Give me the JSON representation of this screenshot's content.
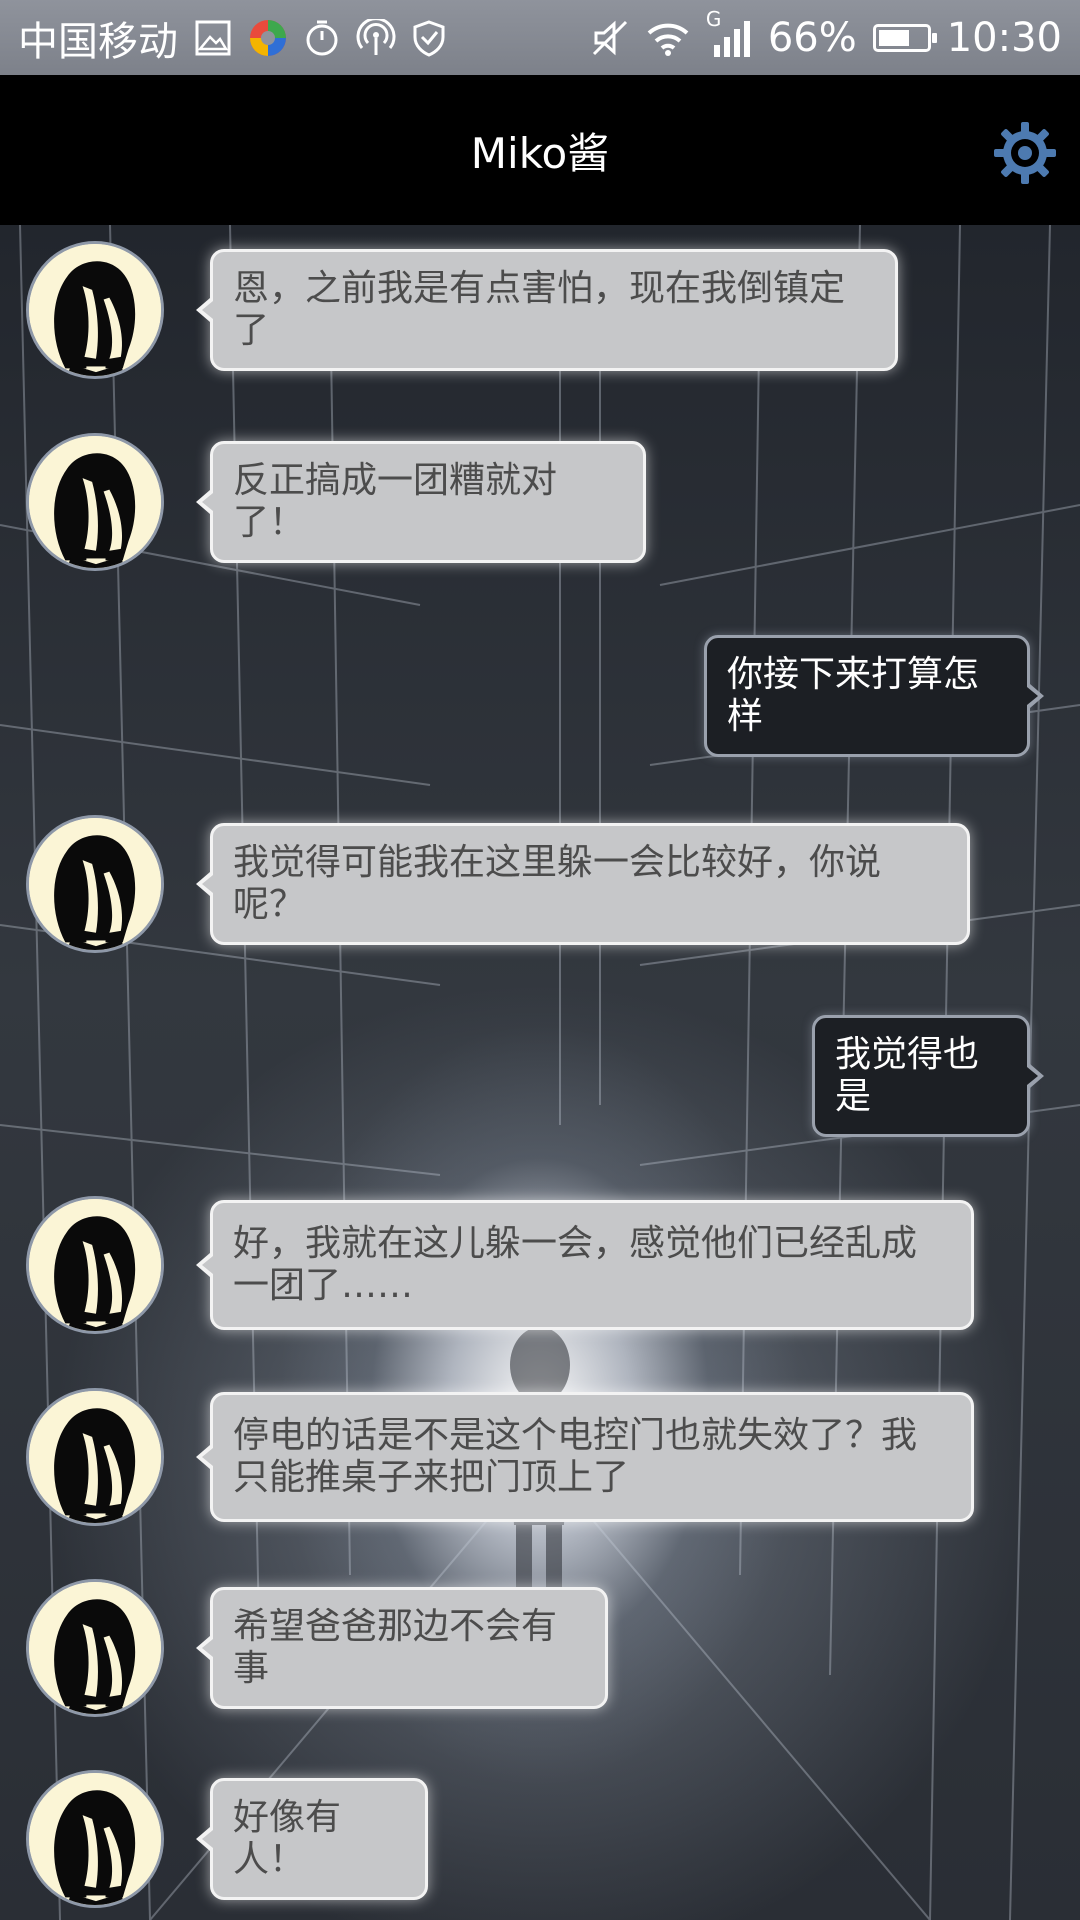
{
  "status_bar": {
    "carrier": "中国移动",
    "battery_text": "66%",
    "battery_level": 0.66,
    "time": "10:30",
    "network_label": "G",
    "icons": [
      "gallery-icon",
      "colorful-app-icon",
      "stopwatch-icon",
      "hotspot-icon",
      "shield-icon",
      "mute-icon",
      "wifi-icon",
      "signal-icon",
      "battery-icon"
    ]
  },
  "header": {
    "title": "Miko酱",
    "settings_icon": "gear-icon"
  },
  "colors": {
    "header_bg": "#000000",
    "incoming_bubble": "#c6c7c9",
    "outgoing_bubble": "#1c1f24",
    "avatar_bg": "#fbf5d6",
    "gear_accent": "#4d7ab0"
  },
  "messages": [
    {
      "side": "in",
      "text": "恩，之前我是有点害怕，现在我倒镇定了"
    },
    {
      "side": "in",
      "text": "反正搞成一团糟就对了！"
    },
    {
      "side": "out",
      "text": "你接下来打算怎样"
    },
    {
      "side": "in",
      "text": "我觉得可能我在这里躲一会比较好，你说呢？"
    },
    {
      "side": "out",
      "text": "我觉得也是"
    },
    {
      "side": "in",
      "text": "好，我就在这儿躲一会，感觉他们已经乱成一团了……"
    },
    {
      "side": "in",
      "text": "停电的话是不是这个电控门也就失效了？我只能推桌子来把门顶上了"
    },
    {
      "side": "in",
      "text": "希望爸爸那边不会有事"
    },
    {
      "side": "in",
      "text": "好像有人！"
    }
  ]
}
